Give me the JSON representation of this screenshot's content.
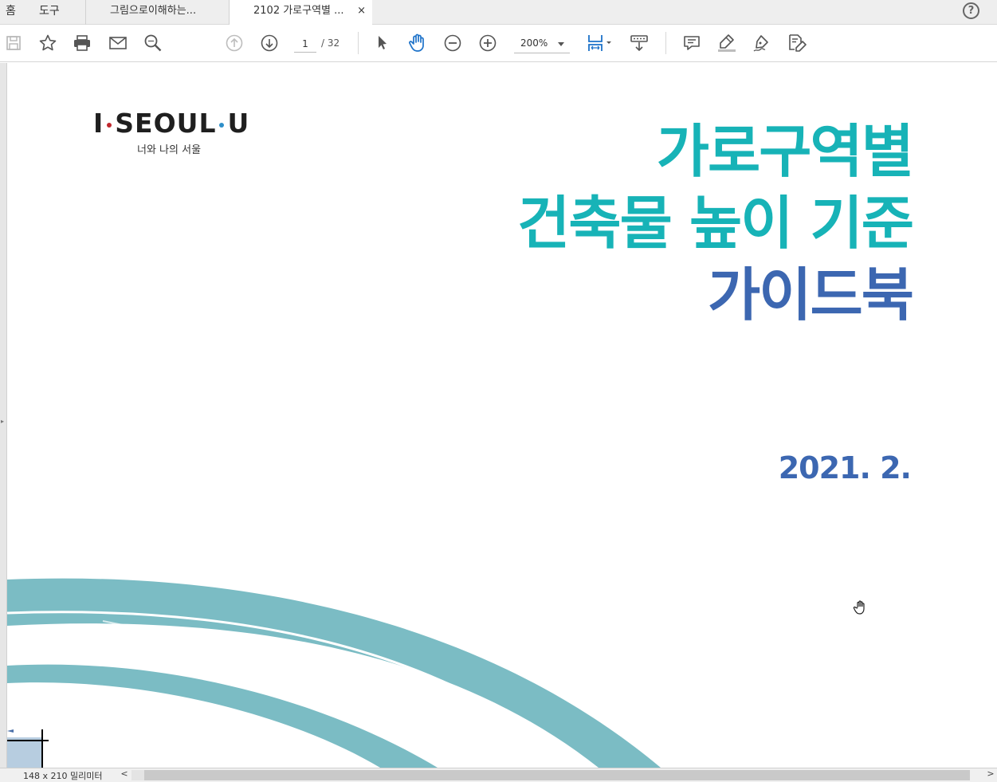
{
  "menu": {
    "home": "홈",
    "tools": "도구"
  },
  "tabs": [
    {
      "label": "그림으로이해하는..."
    },
    {
      "label": "2102 가로구역별 ...",
      "close": "×"
    }
  ],
  "help": "?",
  "toolbar": {
    "page_current": "1",
    "page_total": "/ 32",
    "zoom": "200%"
  },
  "document": {
    "logo_main_1": "I",
    "logo_main_2": "SEOUL",
    "logo_main_3": "U",
    "logo_tagline": "너와 나의 서울",
    "title_line1": "가로구역별",
    "title_line2": "건축물 높이 기준",
    "title_line3": "가이드북",
    "date": "2021. 2.",
    "colors": {
      "teal": "#17b3b7",
      "blue": "#3c67b1",
      "brush": "#7bbcc4"
    }
  },
  "statusbar": {
    "page_size": "148 x 210 밀리미터",
    "scroll_left": "<",
    "scroll_right": ">"
  }
}
